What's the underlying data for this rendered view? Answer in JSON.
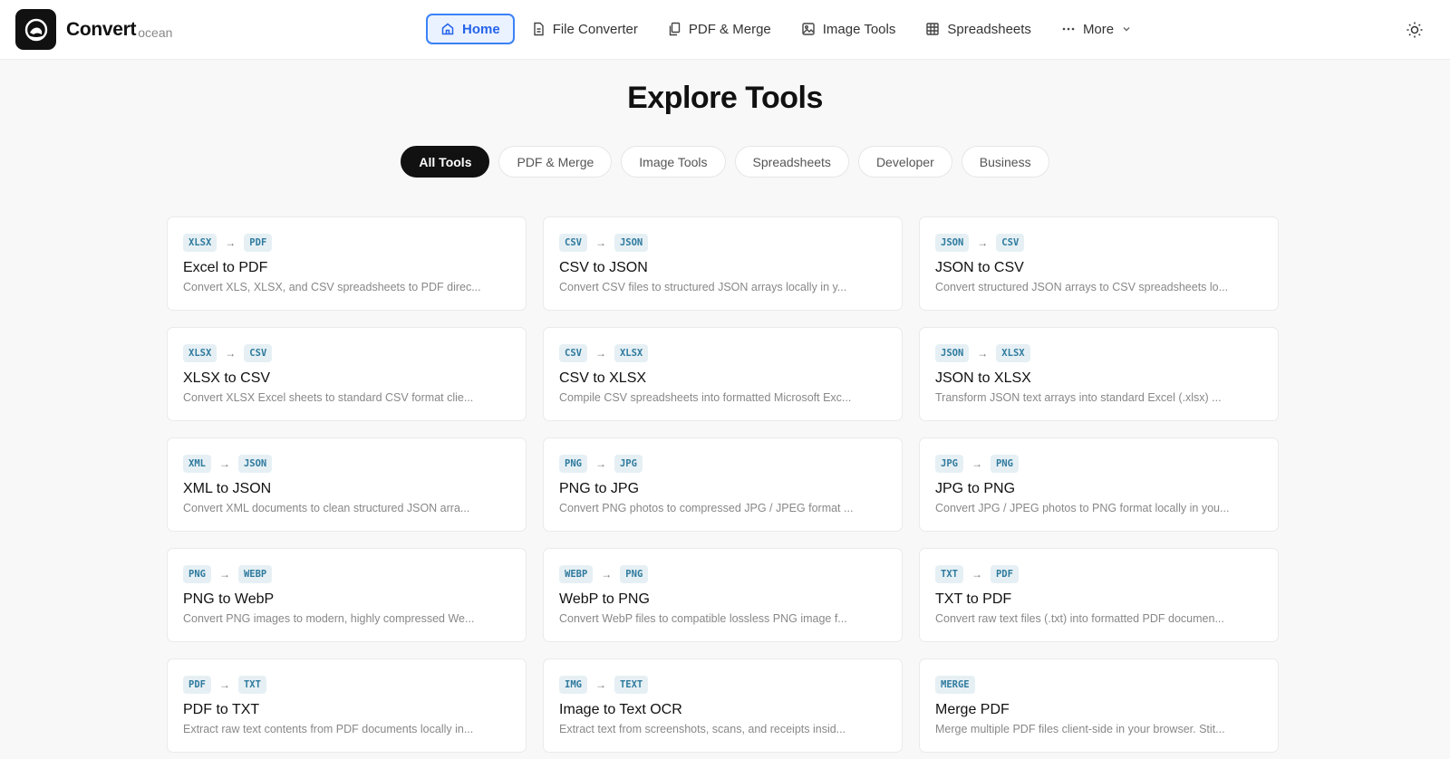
{
  "brand": {
    "name": "Convert",
    "sub": "ocean"
  },
  "nav": {
    "items": [
      {
        "label": "Home",
        "icon": "home-icon"
      },
      {
        "label": "File Converter",
        "icon": "file-icon"
      },
      {
        "label": "PDF & Merge",
        "icon": "copy-icon"
      },
      {
        "label": "Image Tools",
        "icon": "image-icon"
      },
      {
        "label": "Spreadsheets",
        "icon": "grid-icon"
      },
      {
        "label": "More",
        "icon": "dots-icon"
      }
    ]
  },
  "page": {
    "title": "Explore Tools"
  },
  "filters": [
    "All Tools",
    "PDF & Merge",
    "Image Tools",
    "Spreadsheets",
    "Developer",
    "Business"
  ],
  "tools": [
    {
      "from": "XLSX",
      "to": "PDF",
      "title": "Excel to PDF",
      "desc": "Convert XLS, XLSX, and CSV spreadsheets to PDF direc..."
    },
    {
      "from": "CSV",
      "to": "JSON",
      "title": "CSV to JSON",
      "desc": "Convert CSV files to structured JSON arrays locally in y..."
    },
    {
      "from": "JSON",
      "to": "CSV",
      "title": "JSON to CSV",
      "desc": "Convert structured JSON arrays to CSV spreadsheets lo..."
    },
    {
      "from": "XLSX",
      "to": "CSV",
      "title": "XLSX to CSV",
      "desc": "Convert XLSX Excel sheets to standard CSV format clie..."
    },
    {
      "from": "CSV",
      "to": "XLSX",
      "title": "CSV to XLSX",
      "desc": "Compile CSV spreadsheets into formatted Microsoft Exc..."
    },
    {
      "from": "JSON",
      "to": "XLSX",
      "title": "JSON to XLSX",
      "desc": "Transform JSON text arrays into standard Excel (.xlsx) ..."
    },
    {
      "from": "XML",
      "to": "JSON",
      "title": "XML to JSON",
      "desc": "Convert XML documents to clean structured JSON arra..."
    },
    {
      "from": "PNG",
      "to": "JPG",
      "title": "PNG to JPG",
      "desc": "Convert PNG photos to compressed JPG / JPEG format ..."
    },
    {
      "from": "JPG",
      "to": "PNG",
      "title": "JPG to PNG",
      "desc": "Convert JPG / JPEG photos to PNG format locally in you..."
    },
    {
      "from": "PNG",
      "to": "WEBP",
      "title": "PNG to WebP",
      "desc": "Convert PNG images to modern, highly compressed We..."
    },
    {
      "from": "WEBP",
      "to": "PNG",
      "title": "WebP to PNG",
      "desc": "Convert WebP files to compatible lossless PNG image f..."
    },
    {
      "from": "TXT",
      "to": "PDF",
      "title": "TXT to PDF",
      "desc": "Convert raw text files (.txt) into formatted PDF documen..."
    },
    {
      "from": "PDF",
      "to": "TXT",
      "title": "PDF to TXT",
      "desc": "Extract raw text contents from PDF documents locally in..."
    },
    {
      "from": "IMG",
      "to": "TEXT",
      "title": "Image to Text OCR",
      "desc": "Extract text from screenshots, scans, and receipts insid..."
    },
    {
      "from": "MERGE",
      "to": null,
      "title": "Merge PDF",
      "desc": "Merge multiple PDF files client-side in your browser. Stit..."
    }
  ],
  "arrow": "→",
  "colors": {
    "accent": "#3b82f6",
    "tag_text": "#2f7a9e",
    "tag_bg": "#e6f0f4"
  }
}
